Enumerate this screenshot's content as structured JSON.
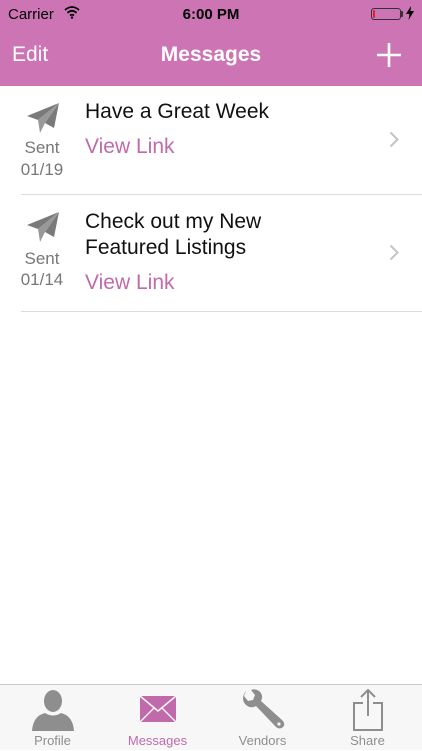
{
  "status_bar": {
    "carrier": "Carrier",
    "time": "6:00 PM",
    "battery_level": 0.08,
    "battery_color": "#e0202a"
  },
  "nav": {
    "left_label": "Edit",
    "title": "Messages",
    "right_icon": "plus-icon",
    "background": "#cc74b4"
  },
  "messages": [
    {
      "title": "Have a Great Week",
      "status": "Sent",
      "date": "01/19",
      "link": "View Link",
      "icon": "paper-plane-icon"
    },
    {
      "title": "Check out my New Featured Listings",
      "status": "Sent",
      "date": "01/14",
      "link": "View Link",
      "icon": "paper-plane-icon"
    }
  ],
  "tabs": [
    {
      "label": "Profile",
      "icon": "person-icon",
      "active": false
    },
    {
      "label": "Messages",
      "icon": "envelope-icon",
      "active": true
    },
    {
      "label": "Vendors",
      "icon": "wrench-icon",
      "active": false
    },
    {
      "label": "Share",
      "icon": "share-icon",
      "active": false
    }
  ],
  "colors": {
    "accent": "#c06aac",
    "inactive_tab": "#8e8e8e"
  }
}
